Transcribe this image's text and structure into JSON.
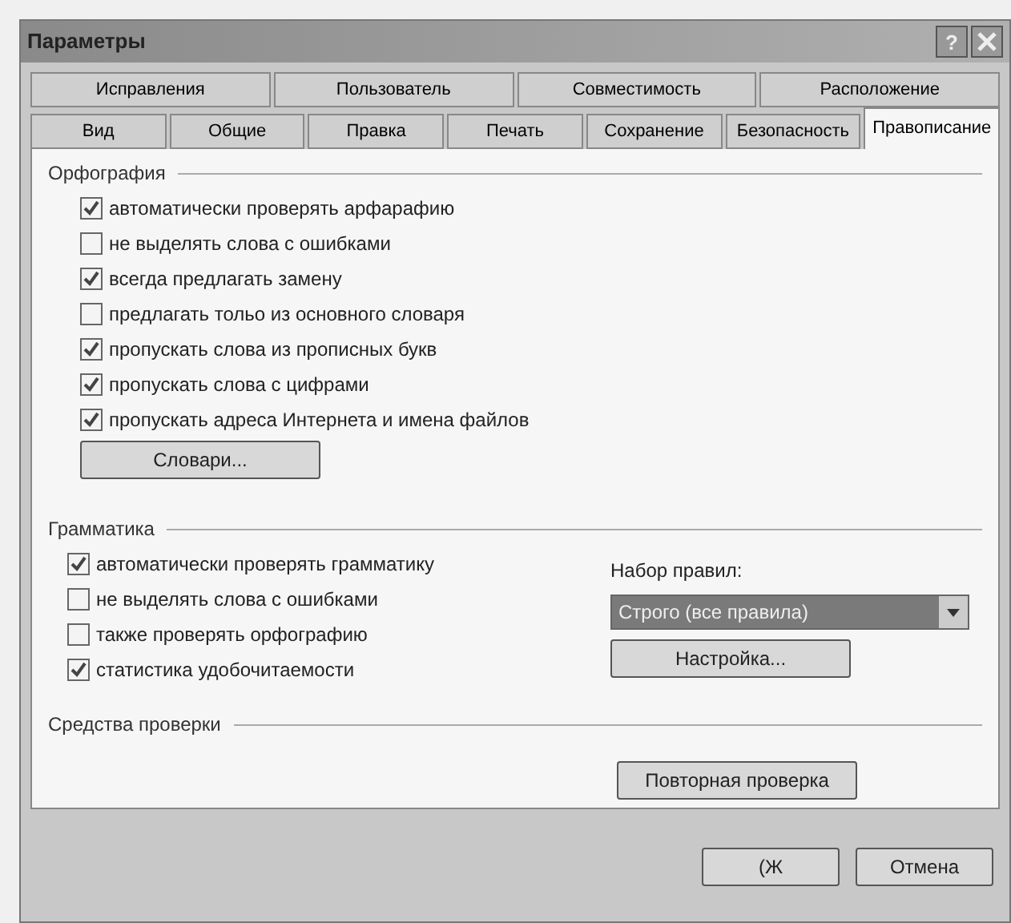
{
  "window": {
    "title": "Параметры",
    "help": "?"
  },
  "tabs_back": [
    {
      "label": "Исправления",
      "selected": false
    },
    {
      "label": "Пользователь",
      "selected": false
    },
    {
      "label": "Совместимость",
      "selected": false
    },
    {
      "label": "Расположение",
      "selected": false
    }
  ],
  "tabs": [
    {
      "label": "Вид",
      "selected": false
    },
    {
      "label": "Общие",
      "selected": false
    },
    {
      "label": "Правка",
      "selected": false
    },
    {
      "label": "Печать",
      "selected": false
    },
    {
      "label": "Сохранение",
      "selected": false
    },
    {
      "label": "Безопасность",
      "selected": false
    },
    {
      "label": "Правописание",
      "selected": true
    }
  ],
  "spelling": {
    "title": "Орфография",
    "options": [
      {
        "label": "автоматически проверять арфарафию",
        "checked": true
      },
      {
        "label": "не выделять слова с ошибками",
        "checked": false
      },
      {
        "label": "всегда предлагать замену",
        "checked": true
      },
      {
        "label": "предлагать тольо из основного словаря",
        "checked": false
      },
      {
        "label": "пропускать слова из прописных букв",
        "checked": true
      },
      {
        "label": "пропускать слова с цифрами",
        "checked": true
      },
      {
        "label": "пропускать адреса Интернета и имена файлов",
        "checked": true
      }
    ],
    "button": "Словари..."
  },
  "grammar": {
    "title": "Грамматика",
    "options": [
      {
        "label": "автоматически проверять грамматику",
        "checked": true
      },
      {
        "label": "не выделять слова с ошибками",
        "checked": false
      },
      {
        "label": "также проверять орфографию",
        "checked": false
      },
      {
        "label": "статистика удобочитаемости",
        "checked": true
      }
    ],
    "ruleset_label": "Набор правил:",
    "ruleset_value": "Строго (все правила)",
    "settings_button": "Настройка..."
  },
  "tools": {
    "title": "Средства проверки",
    "recheck_button": "Повторная проверка"
  },
  "buttons": [
    "(Ж",
    "Отмена"
  ]
}
